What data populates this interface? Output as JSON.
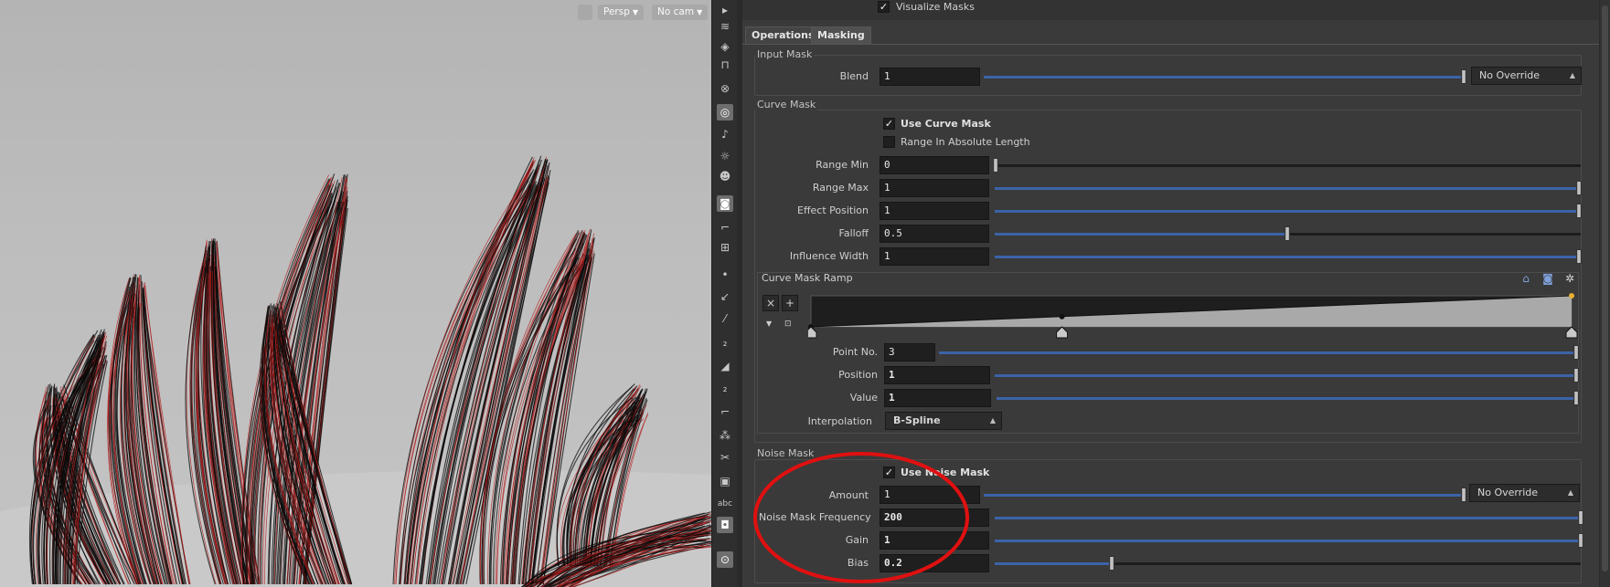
{
  "viewport": {
    "persp_label": "Persp",
    "cam_label": "No cam",
    "hair_color_primary": "#0a0a0a",
    "hair_color_accent": "#b01818"
  },
  "toolbar": {
    "tool_icons": [
      "select-icon",
      "geometry-icon",
      "lock-icon",
      "ghost-icon",
      "snap-icon",
      "light-icon",
      "bulb-icon",
      "skull-icon",
      "camera-icon",
      "eye-icon",
      "display-icon",
      "dot-icon",
      "paint-icon",
      "brush-icon",
      "number-12-icon",
      "broom-icon",
      "number-12b-icon",
      "bracket-icon",
      "scatter-icon",
      "scissors-icon",
      "box-icon",
      "abc-icon",
      "shading-icon",
      "pin-icon"
    ],
    "abc_label": "abc"
  },
  "panel": {
    "visualize_masks_label": "Visualize Masks",
    "tabs": [
      {
        "label": "Operations"
      },
      {
        "label": "Masking"
      }
    ],
    "input_mask": {
      "title": "Input Mask",
      "blend_label": "Blend",
      "blend_value": "1",
      "blend_fraction": 1,
      "override_label": "No Override"
    },
    "curve_mask": {
      "title": "Curve Mask",
      "use_curve_mask_label": "Use Curve Mask",
      "use_curve_mask_checked": true,
      "range_absolute_label": "Range In Absolute Length",
      "range_absolute_checked": false,
      "params": [
        {
          "label": "Range Min",
          "value": "0",
          "fraction": 0
        },
        {
          "label": "Range Max",
          "value": "1",
          "fraction": 1
        },
        {
          "label": "Effect Position",
          "value": "1",
          "fraction": 1
        },
        {
          "label": "Falloff",
          "value": "0.5",
          "fraction": 0.5
        },
        {
          "label": "Influence Width",
          "value": "1",
          "fraction": 1
        }
      ],
      "ramp": {
        "title": "Curve Mask Ramp",
        "points": [
          0,
          0.33,
          1
        ],
        "point_no_label": "Point No.",
        "point_no_value": "3",
        "position_label": "Position",
        "position_value": "1",
        "value_label": "Value",
        "value_value": "1",
        "interpolation_label": "Interpolation",
        "interpolation_value": "B-Spline"
      }
    },
    "noise_mask": {
      "title": "Noise Mask",
      "use_noise_mask_label": "Use Noise Mask",
      "use_noise_mask_checked": true,
      "amount_label": "Amount",
      "amount_value": "1",
      "override_label": "No Override",
      "frequency_label": "Noise Mask Frequency",
      "frequency_value": "200",
      "gain_label": "Gain",
      "gain_value": "1",
      "bias_label": "Bias",
      "bias_value": "0.2",
      "bias_fraction": 0.2
    }
  },
  "annotation_color": "#e01010"
}
